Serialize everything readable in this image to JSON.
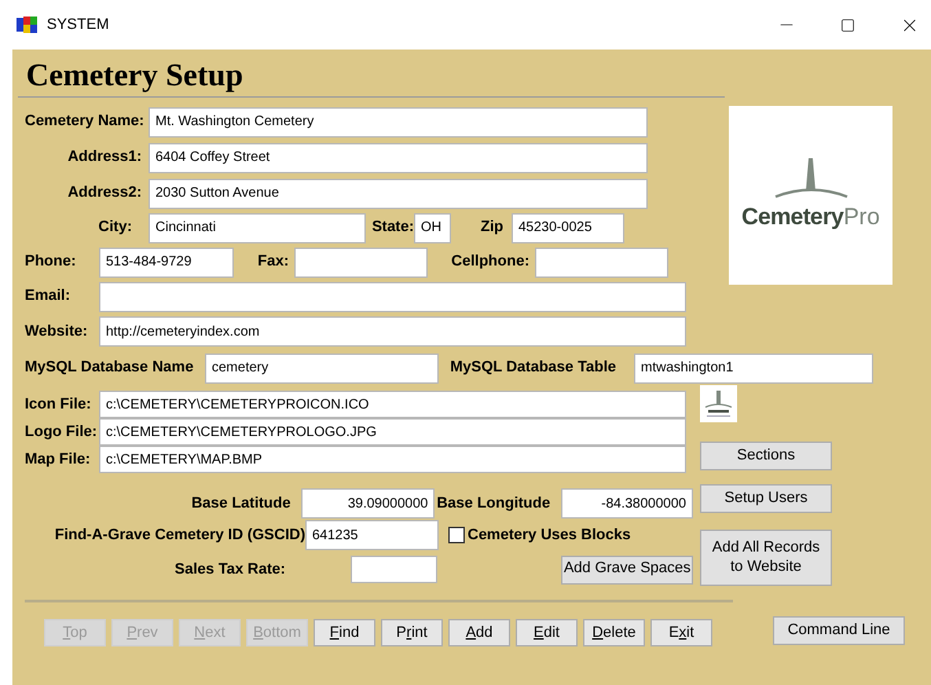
{
  "window": {
    "title": "SYSTEM"
  },
  "heading": "Cemetery Setup",
  "cemetery_name": {
    "label": "Cemetery Name:",
    "value": "Mt. Washington Cemetery"
  },
  "address1": {
    "label": "Address1:",
    "value": "6404 Coffey Street"
  },
  "address2": {
    "label": "Address2:",
    "value": "2030 Sutton Avenue"
  },
  "city": {
    "label": "City:",
    "value": "Cincinnati"
  },
  "state": {
    "label": "State:",
    "value": "OH"
  },
  "zip": {
    "label": "Zip",
    "value": "45230-0025"
  },
  "phone": {
    "label": "Phone:",
    "value": "513-484-9729"
  },
  "fax": {
    "label": "Fax:"
  },
  "cellphone": {
    "label": "Cellphone:"
  },
  "email": {
    "label": "Email:"
  },
  "website": {
    "label": "Website:",
    "value": "http://cemeteryindex.com"
  },
  "mysql_database_name": {
    "label": "MySQL Database Name",
    "value": "cemetery"
  },
  "mysql_database_table": {
    "label": "MySQL Database Table",
    "value": "mtwashington1"
  },
  "logo": {
    "brand": "Cemetery",
    "suffix": "Pro"
  },
  "files": [
    {
      "label": "Icon File:",
      "value": "c:\\CEMETERY\\CEMETERYPROICON.ICO"
    },
    {
      "label": "Logo File:",
      "value": "c:\\CEMETERY\\CEMETERYPROLOGO.JPG"
    },
    {
      "label": "Map File:",
      "value": "c:\\CEMETERY\\MAP.BMP"
    }
  ],
  "base_latitude": {
    "label": "Base Latitude",
    "value": "39.09000000"
  },
  "base_longitude": {
    "label": "Base Longitude",
    "value": "-84.38000000"
  },
  "gscid": {
    "label": "Find-A-Grave Cemetery ID (GSCID)",
    "value": "641235"
  },
  "uses_blocks": {
    "label": "Cemetery Uses Blocks",
    "checked": false
  },
  "sales_tax_rate": {
    "label": "Sales Tax Rate:"
  },
  "add_grave_spaces": "Add Grave Spaces",
  "side_buttons": [
    "Sections",
    "Setup Users",
    "Add All Records to Website"
  ],
  "nav_buttons": [
    {
      "mnemonic": "T",
      "rest": "op",
      "disabled": true
    },
    {
      "mnemonic": "P",
      "rest": "rev",
      "disabled": true
    },
    {
      "mnemonic": "N",
      "rest": "ext",
      "disabled": true
    },
    {
      "mnemonic": "B",
      "rest": "ottom",
      "disabled": true
    },
    {
      "mnemonic": "F",
      "rest": "ind",
      "disabled": false
    },
    {
      "before": "P",
      "mnemonic": "r",
      "rest": "int",
      "disabled": false
    },
    {
      "mnemonic": "A",
      "rest": "dd",
      "disabled": false
    },
    {
      "mnemonic": "E",
      "rest": "dit",
      "disabled": false
    },
    {
      "mnemonic": "D",
      "rest": "elete",
      "disabled": false
    },
    {
      "before": "E",
      "mnemonic": "x",
      "rest": "it",
      "disabled": false
    }
  ],
  "command_line": "Command Line"
}
